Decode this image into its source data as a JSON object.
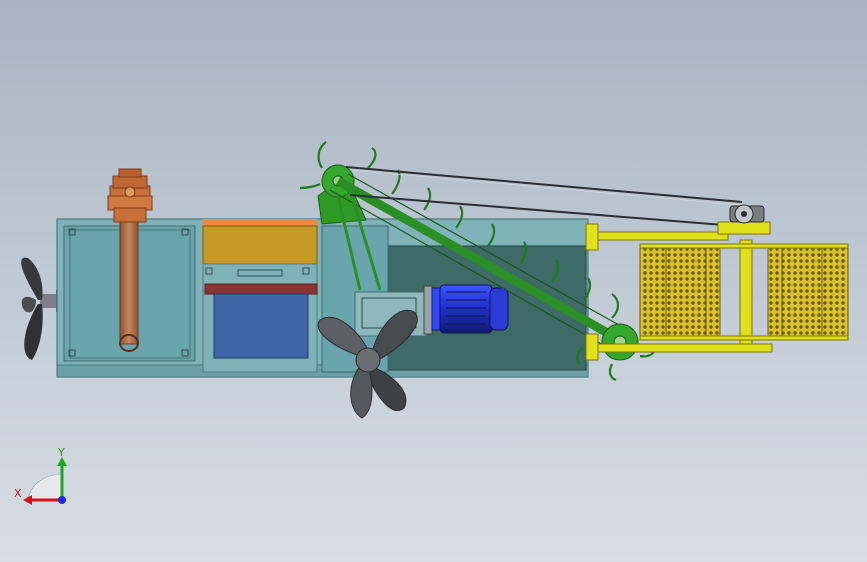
{
  "triad": {
    "x_label": "X",
    "y_label": "Y",
    "x_color": "#d1141a",
    "y_color": "#1fa51f",
    "z_color": "#1f2bd6"
  },
  "colors": {
    "hull": "#7fb3b9",
    "hull_dark": "#55858b",
    "tank_inner": "#6aa5ad",
    "engine_room": "#3e6a68",
    "gearbox": "#c8703a",
    "pipe": "#b5724a",
    "storage_top": "#c79a27",
    "storage_box": "#3f67a8",
    "red_bar": "#8a3434",
    "green_frame": "#2f9b27",
    "motor": "#2436c9",
    "propeller": "#4a4d52",
    "mesh_drum": "#d6bd2b",
    "yellow_frame": "#e2df1b"
  }
}
